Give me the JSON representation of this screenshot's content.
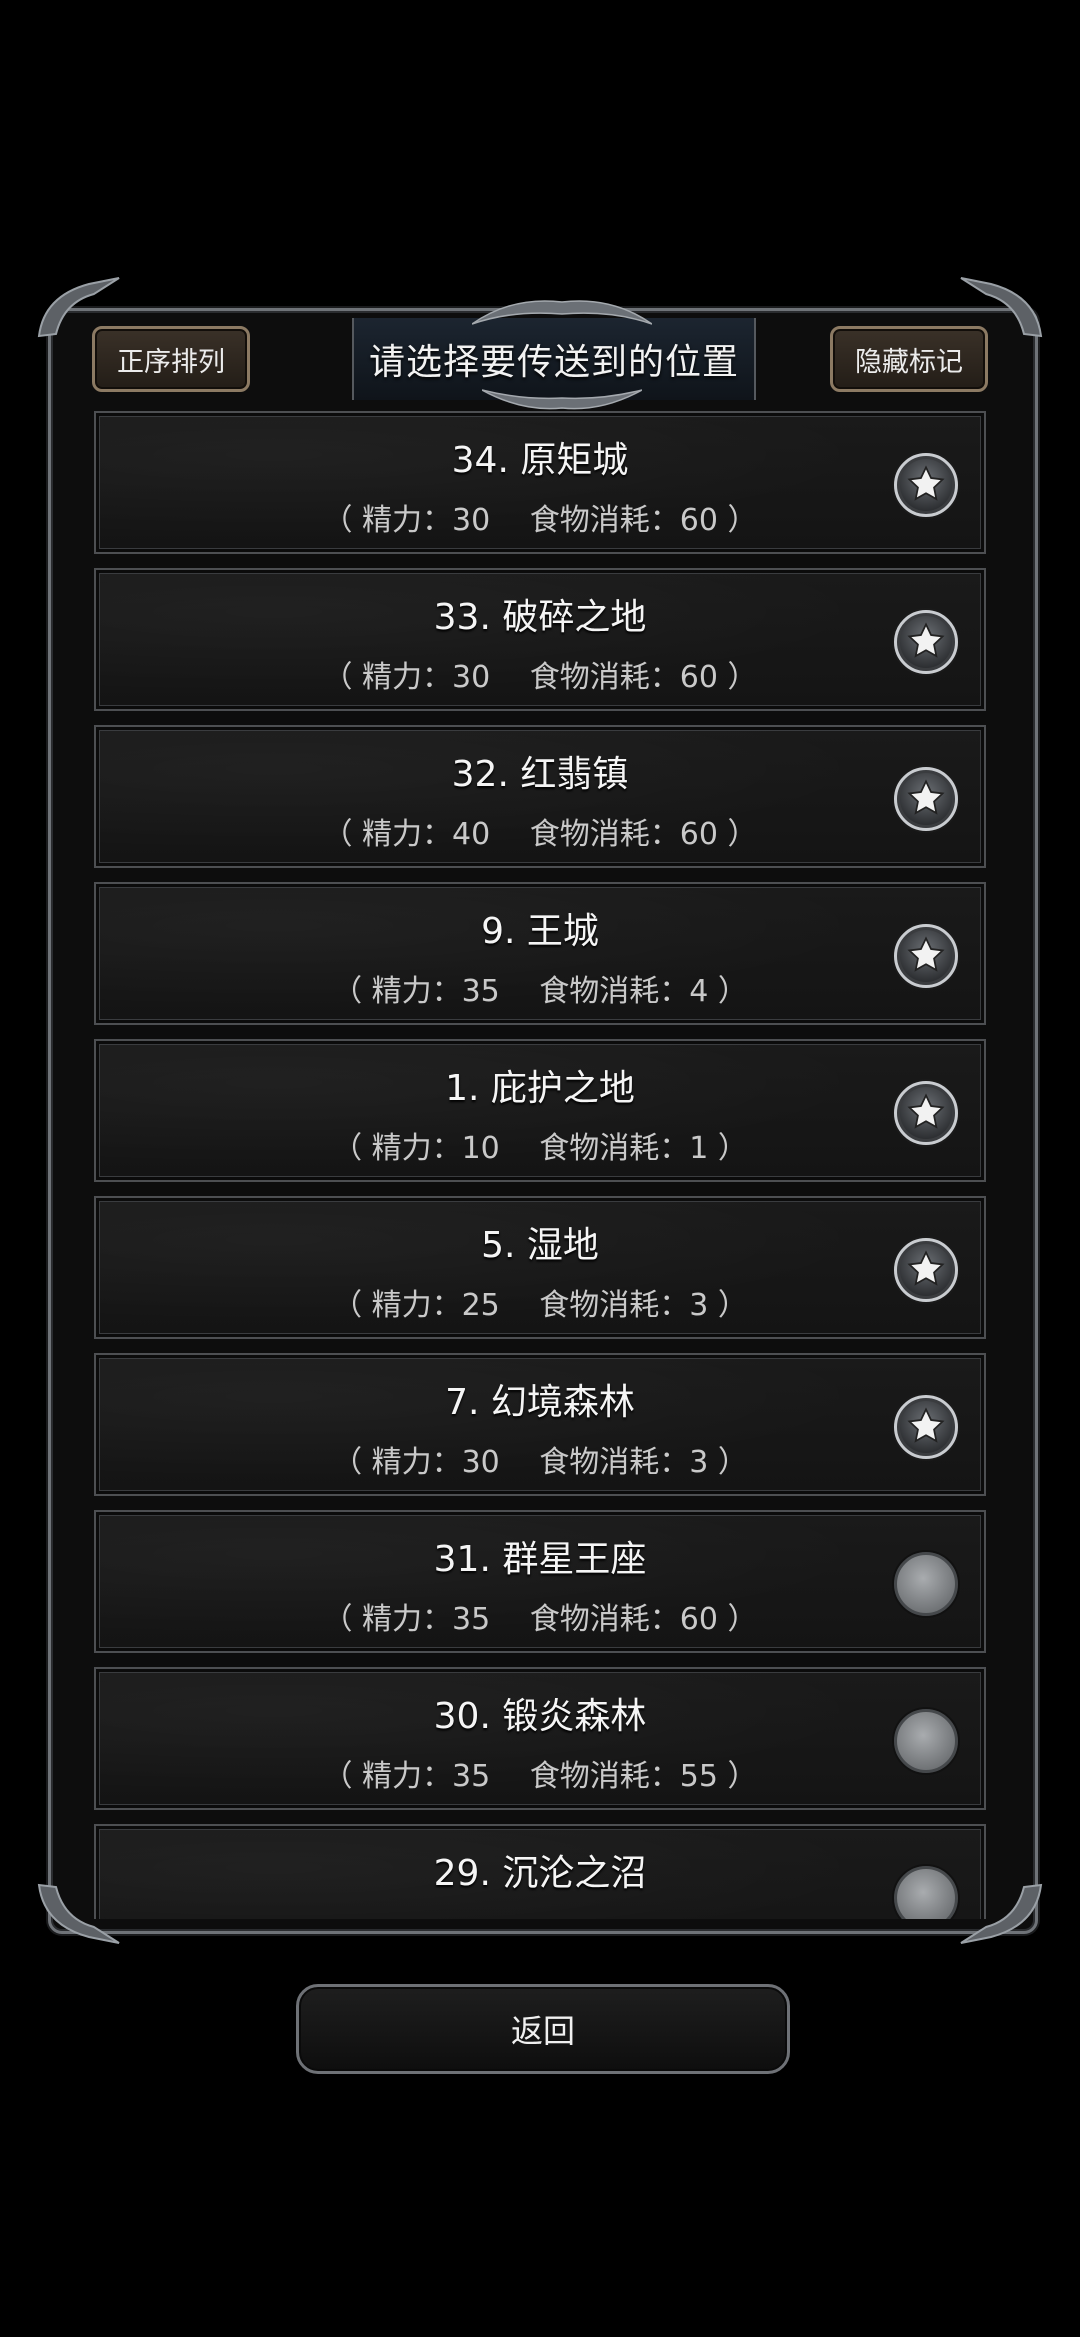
{
  "dialog": {
    "title": "请选择要传送到的位置",
    "sort_button": "正序排列",
    "hide_markers_button": "隐藏标记"
  },
  "locations": [
    {
      "name": "34. 原矩城",
      "cost": "（ 精力：30　 食物消耗：60 ）",
      "marker": "star-icon"
    },
    {
      "name": "33. 破碎之地",
      "cost": "（ 精力：30　 食物消耗：60 ）",
      "marker": "star-icon"
    },
    {
      "name": "32. 红翡镇",
      "cost": "（ 精力：40　 食物消耗：60 ）",
      "marker": "star-icon"
    },
    {
      "name": "9. 王城",
      "cost": "（ 精力：35　 食物消耗：4 ）",
      "marker": "star-icon"
    },
    {
      "name": "1. 庇护之地",
      "cost": "（ 精力：10　 食物消耗：1 ）",
      "marker": "star-icon"
    },
    {
      "name": "5. 湿地",
      "cost": "（ 精力：25　 食物消耗：3 ）",
      "marker": "star-icon"
    },
    {
      "name": "7. 幻境森林",
      "cost": "（ 精力：30　 食物消耗：3 ）",
      "marker": "star-icon"
    },
    {
      "name": "31. 群星王座",
      "cost": "（ 精力：35　 食物消耗：60 ）",
      "marker": "empty-marker"
    },
    {
      "name": "30. 锻炎森林",
      "cost": "（ 精力：35　 食物消耗：55 ）",
      "marker": "empty-marker"
    },
    {
      "name": "29. 沉沦之沼",
      "cost": "",
      "marker": "empty-marker"
    }
  ],
  "back_button": "返回"
}
